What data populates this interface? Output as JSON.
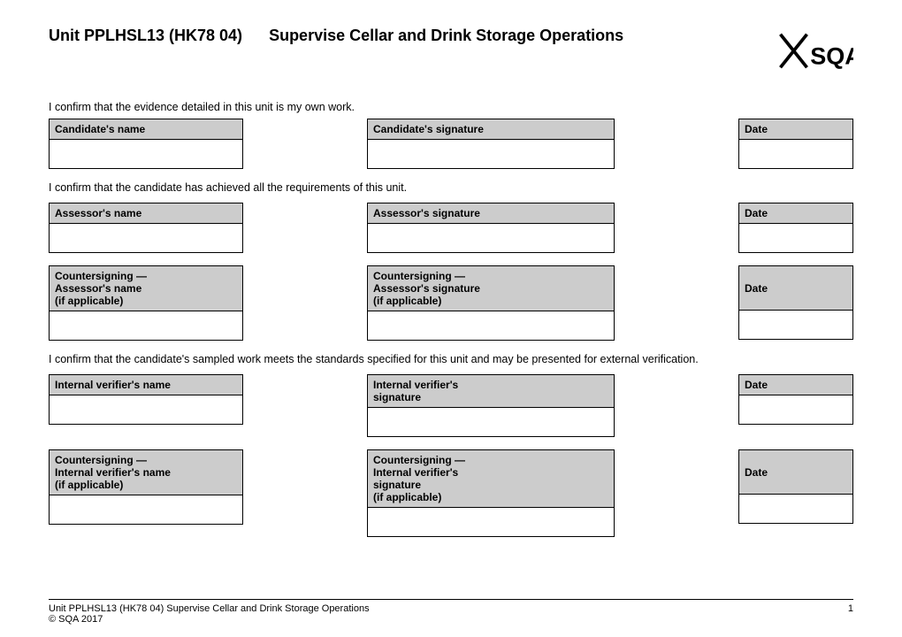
{
  "header": {
    "unit_code": "Unit PPLHSL13 (HK78 04)",
    "unit_title": "Supervise Cellar and Drink Storage Operations"
  },
  "sections": {
    "candidate_confirm": "I confirm that the evidence detailed in this unit is my own work.",
    "assessor_confirm": "I confirm that the candidate has achieved all the requirements of this unit.",
    "verifier_confirm": "I confirm that the candidate's sampled work meets the standards specified for this unit and may be presented for external verification."
  },
  "labels": {
    "candidate_name": "Candidate's name",
    "candidate_signature": "Candidate's signature",
    "assessor_name": "Assessor's name",
    "assessor_signature": "Assessor's signature",
    "countersigning_assessor_name": "Countersigning —\nAssessor's name\n(if applicable)",
    "countersigning_assessor_signature": "Countersigning —\nAssessor's signature\n(if applicable)",
    "internal_verifier_name": "Internal verifier's name",
    "internal_verifier_signature": "Internal verifier's\nsignature",
    "countersigning_iv_name": "Countersigning —\nInternal verifier's name\n(if applicable)",
    "countersigning_iv_signature": "Countersigning —\nInternal verifier's\nsignature\n(if applicable)",
    "date": "Date"
  },
  "footer": {
    "left": "Unit PPLHSL13 (HK78 04) Supervise Cellar and Drink Storage Operations\n© SQA 2017",
    "right": "1"
  }
}
